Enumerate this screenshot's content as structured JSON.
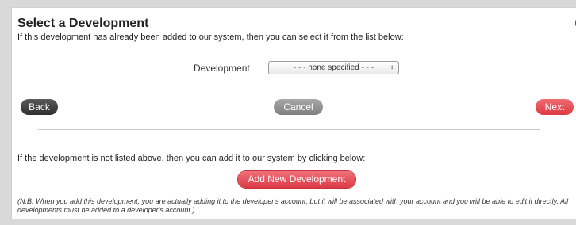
{
  "dialog": {
    "title": "Select a Development",
    "intro": "If this development has already been added to our system, then you can select it from the list below:",
    "close_icon": "close-icon",
    "close_glyph": "✕",
    "accent_color": "#dc3b46"
  },
  "development_select": {
    "label": "Development",
    "value": "- - - none specified - - -",
    "caret": "↕"
  },
  "navigation": {
    "back_label": "Back",
    "cancel_label": "Cancel",
    "next_label": "Next"
  },
  "add_section": {
    "text": "If the development is not listed above, then you can add it to our system by clicking below:",
    "button_label": "Add New Development",
    "note": "(N.B. When you add this development, you are actually adding it to the developer's account, but it will be associated with your account and you will be able to edit it directly. All developments must be added to a developer's account.)"
  }
}
